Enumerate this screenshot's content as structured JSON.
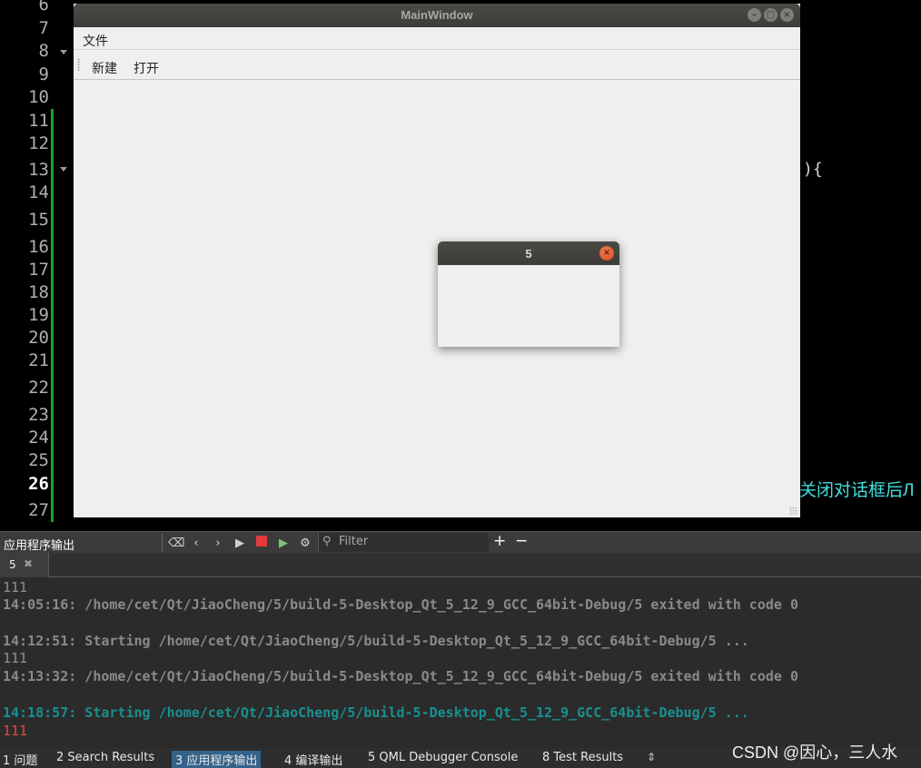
{
  "editor": {
    "line_numbers": [
      "6",
      "7",
      "8",
      "9",
      "10",
      "11",
      "12",
      "13",
      "14",
      "15",
      "16",
      "17",
      "18",
      "19",
      "20",
      "21",
      "22",
      "23",
      "24",
      "25",
      "26",
      "27"
    ],
    "current_line": "26",
    "code_tail_13": "){",
    "code_tail_26": "关闭对话框后Л"
  },
  "main_window": {
    "title": "MainWindow",
    "menu_file": "文件",
    "toolbar_new": "新建",
    "toolbar_open": "打开"
  },
  "dialog": {
    "title": "5"
  },
  "output_pane": {
    "title": "应用程序输出",
    "filter_placeholder": "Filter",
    "tab_label": "5",
    "add_symbol": "+",
    "remove_symbol": "−"
  },
  "log_lines": [
    {
      "text": "111",
      "style": "grey"
    },
    {
      "text": "14:05:16: /home/cet/Qt/JiaoCheng/5/build-5-Desktop_Qt_5_12_9_GCC_64bit-Debug/5 exited with code 0",
      "style": "bold"
    },
    {
      "text": "",
      "style": "grey"
    },
    {
      "text": "14:12:51: Starting /home/cet/Qt/JiaoCheng/5/build-5-Desktop_Qt_5_12_9_GCC_64bit-Debug/5 ...",
      "style": "bold"
    },
    {
      "text": "111",
      "style": "grey"
    },
    {
      "text": "14:13:32: /home/cet/Qt/JiaoCheng/5/build-5-Desktop_Qt_5_12_9_GCC_64bit-Debug/5 exited with code 0",
      "style": "bold"
    },
    {
      "text": "",
      "style": "grey"
    },
    {
      "text": "14:18:57: Starting /home/cet/Qt/JiaoCheng/5/build-5-Desktop_Qt_5_12_9_GCC_64bit-Debug/5 ...",
      "style": "teal"
    },
    {
      "text": "111",
      "style": "red"
    }
  ],
  "statusbar": {
    "items": [
      {
        "label": "1 问题"
      },
      {
        "label": "2 Search Results"
      },
      {
        "label": "3 应用程序输出"
      },
      {
        "label": "4 编译输出"
      },
      {
        "label": "5 QML Debugger Console"
      },
      {
        "label": "8 Test Results"
      }
    ],
    "active_index": 2
  },
  "watermark": "CSDN @因心，三人水",
  "colors": {
    "editor_bg": "#000000",
    "gutter_marker": "#1fa31f",
    "log_teal": "#1a8f8f",
    "log_red": "#e24848",
    "active_tab": "#34628a",
    "close_button": "#e2572a"
  }
}
